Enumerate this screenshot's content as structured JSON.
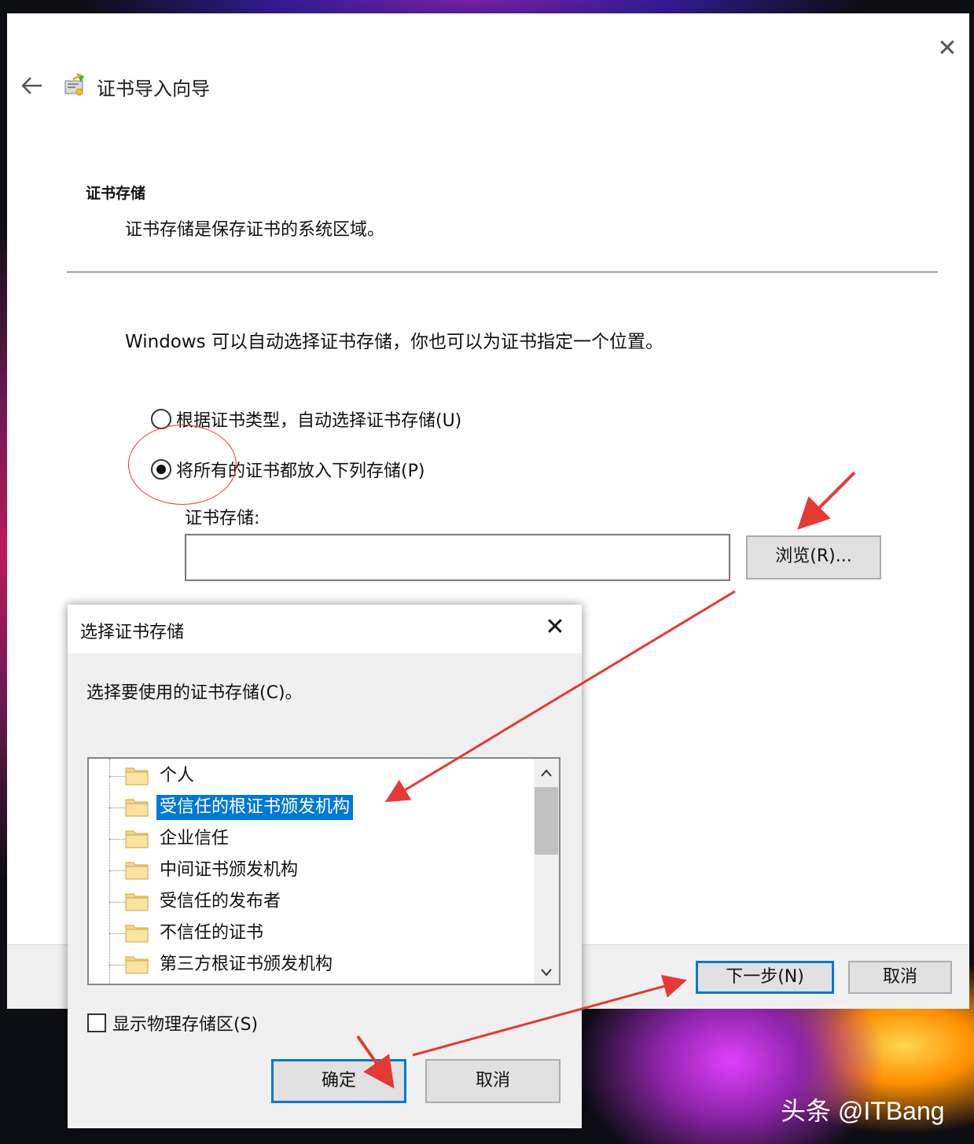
{
  "wizard": {
    "title": "证书导入向导",
    "close_glyph": "✕",
    "section_title": "证书存储",
    "section_desc": "证书存储是保存证书的系统区域。",
    "intro": "Windows 可以自动选择证书存储，你也可以为证书指定一个位置。",
    "radio_auto": "根据证书类型，自动选择证书存储(U)",
    "radio_manual": "将所有的证书都放入下列存储(P)",
    "selected_option": "manual",
    "store_label": "证书存储:",
    "store_value": "",
    "browse_button": "浏览(R)...",
    "next_button": "下一步(N)",
    "cancel_button": "取消"
  },
  "modal": {
    "title": "选择证书存储",
    "close_glyph": "✕",
    "description": "选择要使用的证书存储(C)。",
    "stores": [
      "个人",
      "受信任的根证书颁发机构",
      "企业信任",
      "中间证书颁发机构",
      "受信任的发布者",
      "不信任的证书",
      "第三方根证书颁发机构"
    ],
    "selected_index": 1,
    "show_physical_label": "显示物理存储区(S)",
    "show_physical_checked": false,
    "ok_button": "确定",
    "cancel_button": "取消"
  },
  "watermark": "头条 @ITBang",
  "colors": {
    "accent": "#0078d7",
    "annotation": "#e53935"
  }
}
